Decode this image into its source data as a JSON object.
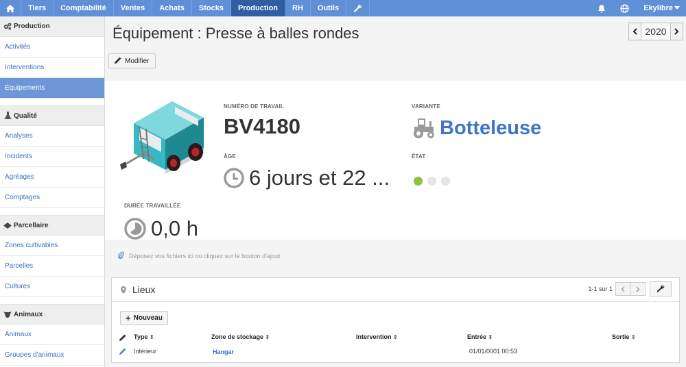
{
  "topnav": {
    "items": [
      "Tiers",
      "Comptabilité",
      "Ventes",
      "Achats",
      "Stocks",
      "Production",
      "RH",
      "Outils"
    ],
    "active": "Production",
    "user": "Ekylibre"
  },
  "sidebar": {
    "sections": [
      {
        "title": "Production",
        "icon": "gears-icon",
        "links": [
          "Activités",
          "Interventions",
          "Équipements"
        ]
      },
      {
        "title": "Qualité",
        "icon": "flask-icon",
        "links": [
          "Analyses",
          "Incidents",
          "Agréages",
          "Comptages"
        ]
      },
      {
        "title": "Parcellaire",
        "icon": "map-icon",
        "links": [
          "Zones cultivables",
          "Parcelles",
          "Cultures"
        ]
      },
      {
        "title": "Animaux",
        "icon": "cow-icon",
        "links": [
          "Animaux",
          "Groupes d'animaux"
        ]
      }
    ],
    "active_link": "Équipements"
  },
  "page": {
    "title": "Équipement : Presse à balles rondes",
    "year": "2020",
    "modify_label": "Modifier"
  },
  "hero": {
    "work_number_label": "NUMÉRO DE TRAVAIL",
    "work_number": "BV4180",
    "variant_label": "VARIANTE",
    "variant": "Botteleuse",
    "age_label": "ÂGE",
    "age": "6 jours et 22 ...",
    "state_label": "ÉTAT",
    "duration_label": "DURÉE TRAVAILLÉE",
    "duration": "0,0 h",
    "state_active_index": 0
  },
  "drop_zone": "Déposez vos fichiers ici ou cliquez sur le bouton d'ajout",
  "places": {
    "title": "Lieux",
    "pagination": "1-1 sur 1",
    "new_label": "Nouveau",
    "columns": [
      "Type",
      "Zone de stockage",
      "Intervention",
      "Entrée",
      "Sortie"
    ],
    "rows": [
      {
        "type": "Intérieur",
        "zone": "Hangar",
        "intervention": "",
        "entry": "01/01/0001 00:53",
        "exit": ""
      }
    ]
  },
  "colors": {
    "nav": "#5f8fd6",
    "nav_active": "#2f5ea4",
    "accent": "#3f74c6",
    "state_on": "#8dc23b"
  }
}
